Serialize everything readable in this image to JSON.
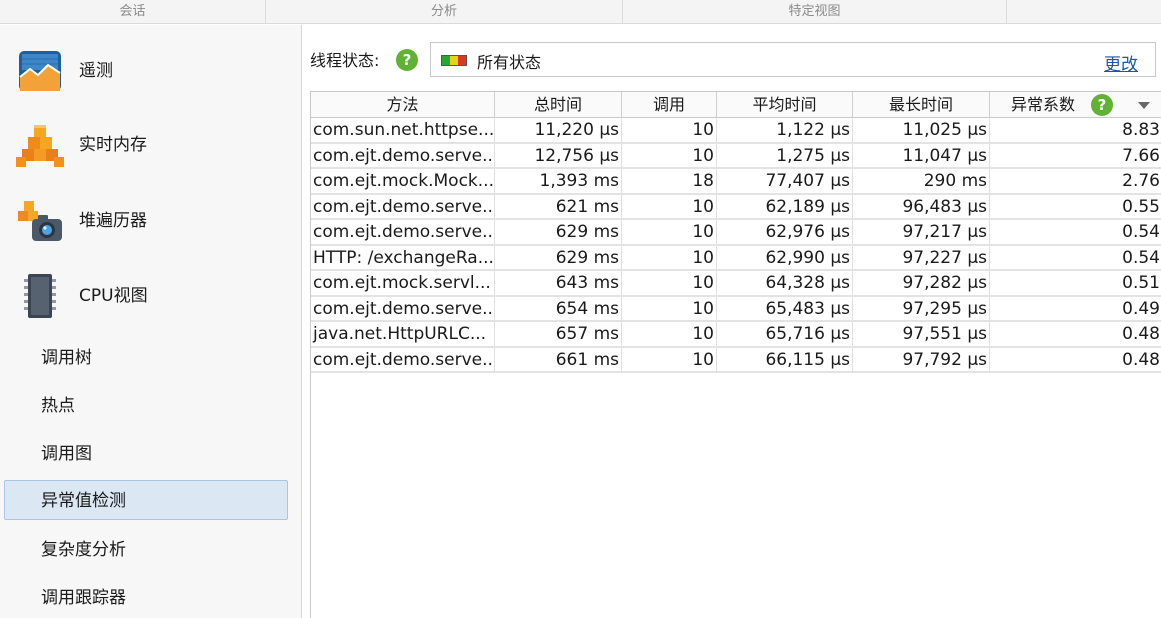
{
  "top_groups": [
    "会话",
    "分析",
    "特定视图"
  ],
  "sidebar": {
    "big_items": [
      {
        "label": "遥测",
        "icon": "telemetry-icon"
      },
      {
        "label": "实时内存",
        "icon": "live-memory-icon"
      },
      {
        "label": "堆遍历器",
        "icon": "heap-walker-icon"
      },
      {
        "label": "CPU视图",
        "icon": "cpu-chip-icon"
      }
    ],
    "sub_items": [
      {
        "label": "调用树",
        "active": false
      },
      {
        "label": "热点",
        "active": false
      },
      {
        "label": "调用图",
        "active": false
      },
      {
        "label": "异常值检测",
        "active": true
      },
      {
        "label": "复杂度分析",
        "active": false
      },
      {
        "label": "调用跟踪器",
        "active": false
      }
    ]
  },
  "filter": {
    "label": "线程状态:",
    "help_glyph": "?",
    "state_text": "所有状态",
    "state_colors": [
      "#2aa632",
      "#e8d21a",
      "#d83a2a"
    ],
    "change_label": "更改"
  },
  "table": {
    "columns": [
      "方法",
      "总时间",
      "调用",
      "平均时间",
      "最长时间",
      "异常系数"
    ],
    "rows": [
      [
        "com.sun.net.httpse...",
        "11,220 µs",
        "10",
        "1,122 µs",
        "11,025 µs",
        "8.83"
      ],
      [
        "com.ejt.demo.serve...",
        "12,756 µs",
        "10",
        "1,275 µs",
        "11,047 µs",
        "7.66"
      ],
      [
        "com.ejt.mock.Mock...",
        "1,393 ms",
        "18",
        "77,407 µs",
        "290 ms",
        "2.76"
      ],
      [
        "com.ejt.demo.serve...",
        "621 ms",
        "10",
        "62,189 µs",
        "96,483 µs",
        "0.55"
      ],
      [
        "com.ejt.demo.serve...",
        "629 ms",
        "10",
        "62,976 µs",
        "97,217 µs",
        "0.54"
      ],
      [
        "HTTP: /exchangeRa...",
        "629 ms",
        "10",
        "62,990 µs",
        "97,227 µs",
        "0.54"
      ],
      [
        "com.ejt.mock.servl...",
        "643 ms",
        "10",
        "64,328 µs",
        "97,282 µs",
        "0.51"
      ],
      [
        "com.ejt.demo.serve...",
        "654 ms",
        "10",
        "65,483 µs",
        "97,295 µs",
        "0.49"
      ],
      [
        "java.net.HttpURLC...",
        "657 ms",
        "10",
        "65,716 µs",
        "97,551 µs",
        "0.48"
      ],
      [
        "com.ejt.demo.serve...",
        "661 ms",
        "10",
        "66,115 µs",
        "97,792 µs",
        "0.48"
      ]
    ]
  }
}
